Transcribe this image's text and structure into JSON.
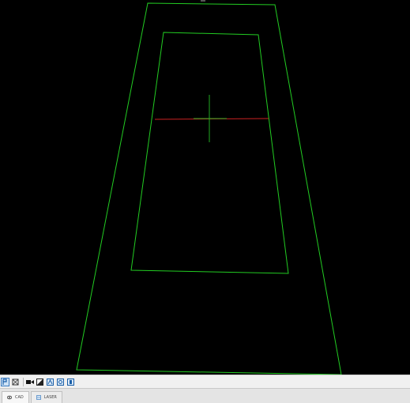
{
  "toolbar": {
    "buttons": [
      {
        "name": "select-tool-icon",
        "active": true
      },
      {
        "name": "zoom-fit-icon",
        "active": false
      },
      {
        "name": "camera-icon",
        "active": false
      },
      {
        "name": "exposure-icon",
        "active": false
      },
      {
        "name": "view-top-icon",
        "active": false
      },
      {
        "name": "view-perspective-icon",
        "active": false
      },
      {
        "name": "view-front-icon",
        "active": false
      }
    ]
  },
  "tabs": [
    {
      "label": "CAD",
      "icon": "eye-icon",
      "selected": true
    },
    {
      "label": "LASER",
      "icon": "layers-icon",
      "selected": false
    }
  ],
  "colors": {
    "outline": "#22cc22",
    "axis_horizontal": "#cc2222",
    "axis_vertical": "#22aa22",
    "background": "#000000"
  }
}
